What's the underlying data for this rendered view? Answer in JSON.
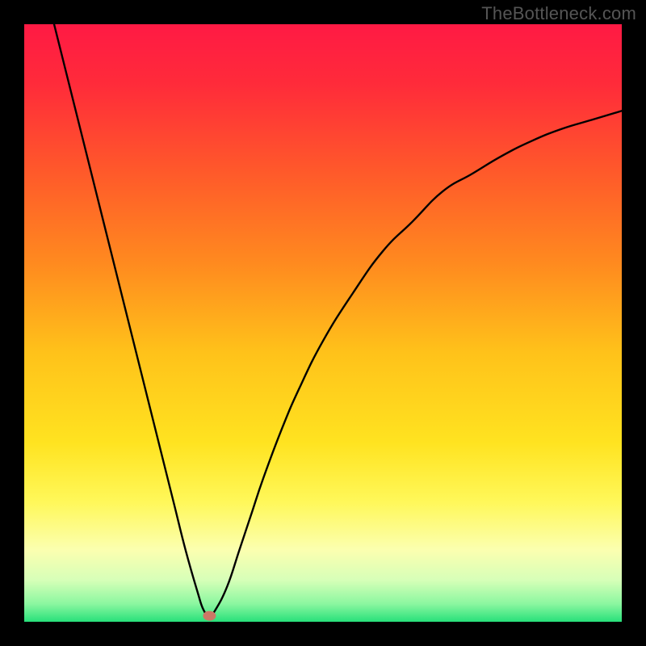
{
  "watermark": "TheBottleneck.com",
  "colors": {
    "gradient_stops": [
      {
        "offset": 0.0,
        "color": "#ff1a44"
      },
      {
        "offset": 0.1,
        "color": "#ff2b3a"
      },
      {
        "offset": 0.25,
        "color": "#ff5a2a"
      },
      {
        "offset": 0.4,
        "color": "#ff8a1f"
      },
      {
        "offset": 0.55,
        "color": "#ffc21a"
      },
      {
        "offset": 0.7,
        "color": "#ffe320"
      },
      {
        "offset": 0.8,
        "color": "#fff85a"
      },
      {
        "offset": 0.88,
        "color": "#fbffb0"
      },
      {
        "offset": 0.93,
        "color": "#d7ffb8"
      },
      {
        "offset": 0.97,
        "color": "#8bf7a0"
      },
      {
        "offset": 1.0,
        "color": "#28e07a"
      }
    ],
    "curve": "#000000",
    "marker": "#cc7766"
  },
  "chart_data": {
    "type": "line",
    "title": "",
    "xlabel": "",
    "ylabel": "",
    "xlim": [
      0,
      100
    ],
    "ylim": [
      0,
      100
    ],
    "grid": false,
    "legend": false,
    "annotations": [],
    "series": [
      {
        "name": "bottleneck-curve",
        "x": [
          5,
          7.5,
          10,
          12.5,
          15,
          17.5,
          20,
          22.5,
          25,
          27,
          29,
          30,
          31,
          32,
          34,
          36,
          38,
          40,
          43,
          46,
          50,
          55,
          60,
          65,
          70,
          75,
          80,
          85,
          90,
          95,
          100
        ],
        "y": [
          100,
          90,
          80,
          70,
          60,
          50,
          40,
          30,
          20,
          12,
          5,
          2,
          1,
          2,
          6,
          12,
          18,
          24,
          32,
          39,
          47,
          55,
          62,
          67,
          72,
          75,
          78,
          80.5,
          82.5,
          84,
          85.5
        ]
      },
      {
        "name": "optimum-marker",
        "x": [
          31
        ],
        "y": [
          1
        ]
      }
    ]
  }
}
